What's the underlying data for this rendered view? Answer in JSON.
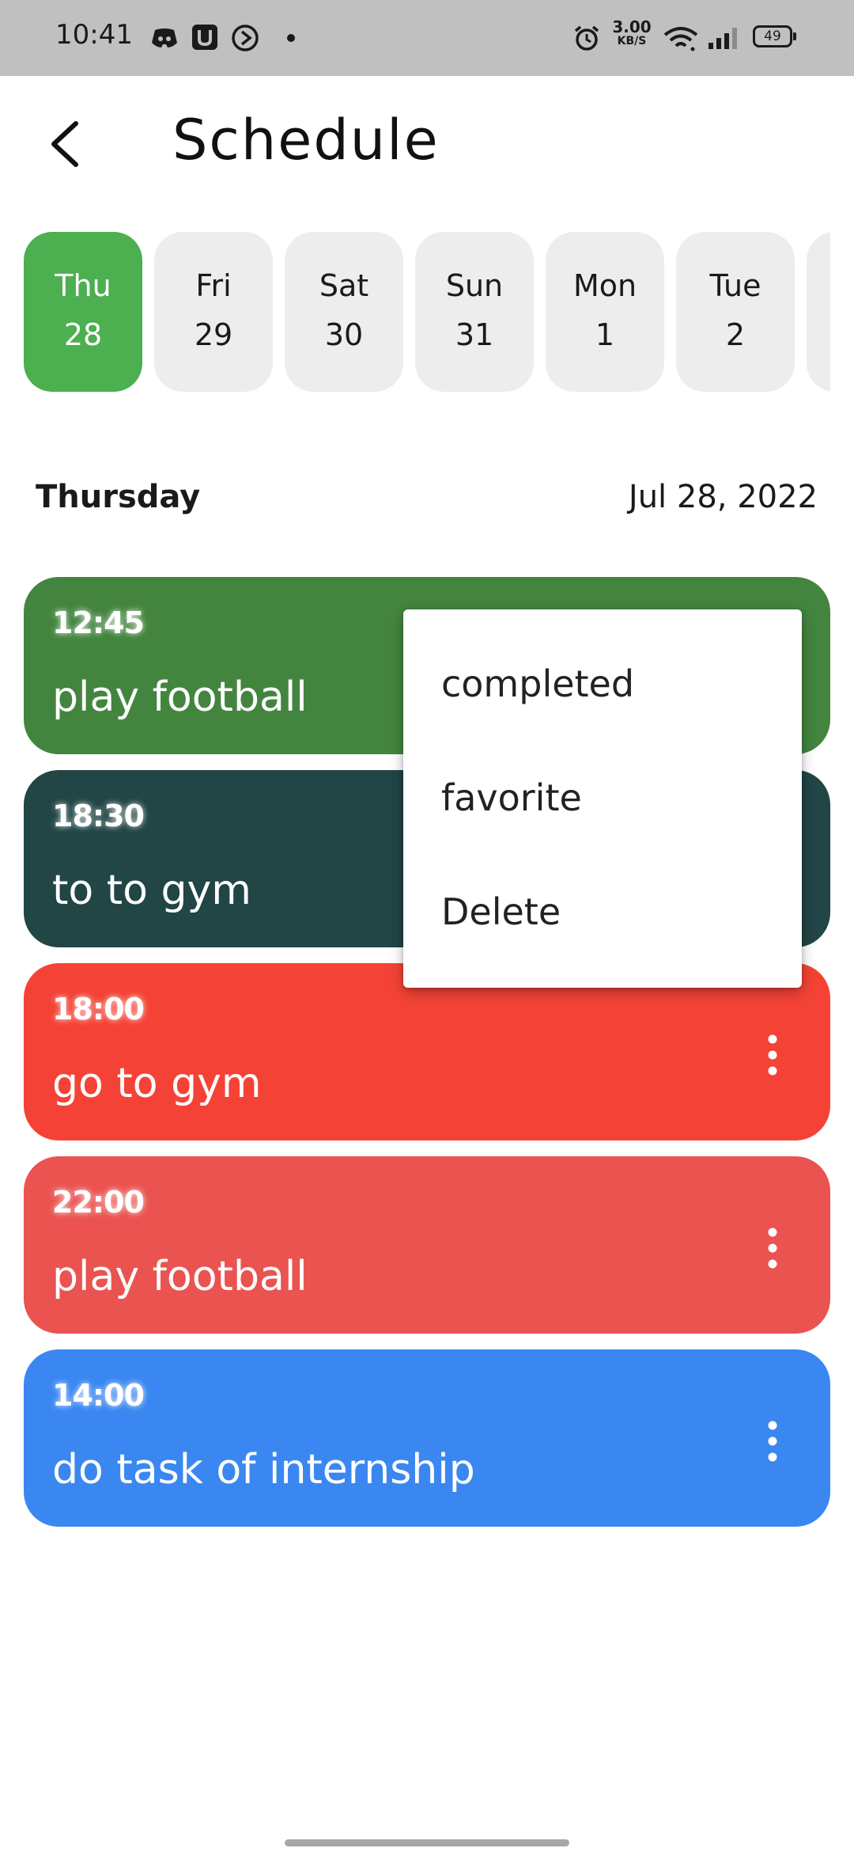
{
  "status_bar": {
    "time": "10:41",
    "net_speed_value": "3.00",
    "net_speed_unit": "KB/S",
    "battery_level": "49",
    "left_icons": [
      "discord-icon",
      "u-app-icon",
      "play-circle-icon",
      "notification-dot-icon"
    ],
    "right_icons": [
      "alarm-icon",
      "wifi-icon",
      "signal-icon",
      "battery-icon"
    ]
  },
  "header": {
    "back_icon": "back-chevron-icon",
    "title": "Schedule"
  },
  "days": [
    {
      "name": "Thu",
      "num": "28",
      "active": true
    },
    {
      "name": "Fri",
      "num": "29",
      "active": false
    },
    {
      "name": "Sat",
      "num": "30",
      "active": false
    },
    {
      "name": "Sun",
      "num": "31",
      "active": false
    },
    {
      "name": "Mon",
      "num": "1",
      "active": false
    },
    {
      "name": "Tue",
      "num": "2",
      "active": false
    }
  ],
  "selected": {
    "weekday": "Thursday",
    "date": "Jul 28, 2022"
  },
  "tasks": [
    {
      "time": "12:45",
      "title": "play football",
      "color": "#43853f"
    },
    {
      "time": "18:30",
      "title": "to to gym",
      "color": "#224545"
    },
    {
      "time": "18:00",
      "title": "go to gym",
      "color": "#f44336"
    },
    {
      "time": "22:00",
      "title": "play football",
      "color": "#ea5350"
    },
    {
      "time": "14:00",
      "title": "do task of internship",
      "color": "#3a87f1"
    }
  ],
  "menu": {
    "items": [
      "completed",
      "favorite",
      "Delete"
    ]
  },
  "colors": {
    "accent": "#4caf50",
    "pill_bg": "#ededed",
    "status_bar_bg": "#c0c0c0"
  }
}
